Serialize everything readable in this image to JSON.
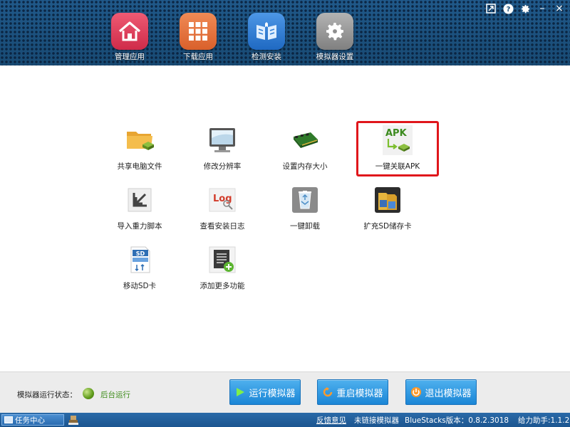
{
  "window_controls": {
    "restore": "restore-icon",
    "help": "?",
    "settings": "gear-icon",
    "minimize": "–",
    "close": "×"
  },
  "nav": {
    "items": [
      {
        "label": "管理应用",
        "icon": "home-icon",
        "color": "#e2435f"
      },
      {
        "label": "下载应用",
        "icon": "grid-icon",
        "color": "#e8743f"
      },
      {
        "label": "检测安装",
        "icon": "book-icon",
        "color": "#2f7fd6"
      },
      {
        "label": "模拟器设置",
        "icon": "gear-icon",
        "color": "#9a9a9a"
      }
    ]
  },
  "tools": [
    {
      "label": "共享电脑文件",
      "icon": "folder-icon"
    },
    {
      "label": "修改分辨率",
      "icon": "monitor-icon"
    },
    {
      "label": "设置内存大小",
      "icon": "memory-icon"
    },
    {
      "label": "一键关联APK",
      "icon": "apk-icon",
      "icon_text": "APK",
      "selected": true
    },
    {
      "label": "导入重力脚本",
      "icon": "import-icon"
    },
    {
      "label": "查看安装日志",
      "icon": "log-icon",
      "icon_text": "Log"
    },
    {
      "label": "一键卸载",
      "icon": "recycle-bin-icon"
    },
    {
      "label": "扩充SD储存卡",
      "icon": "sd-expand-icon"
    },
    {
      "label": "移动SD卡",
      "icon": "sd-move-icon",
      "icon_text": "SD"
    },
    {
      "label": "添加更多功能",
      "icon": "add-feature-icon"
    }
  ],
  "status": {
    "label": "模拟器运行状态：",
    "value": "后台运行",
    "color": "#3a8a16"
  },
  "actions": {
    "run": "运行模拟器",
    "restart": "重启模拟器",
    "exit": "退出模拟器"
  },
  "taskbar": {
    "task_center": "任务中心",
    "feedback": "反馈意见",
    "connection": "未链接模拟器",
    "version": "BlueStacks版本：0.8.2.3018",
    "helper": "给力助手:1.1.2"
  }
}
